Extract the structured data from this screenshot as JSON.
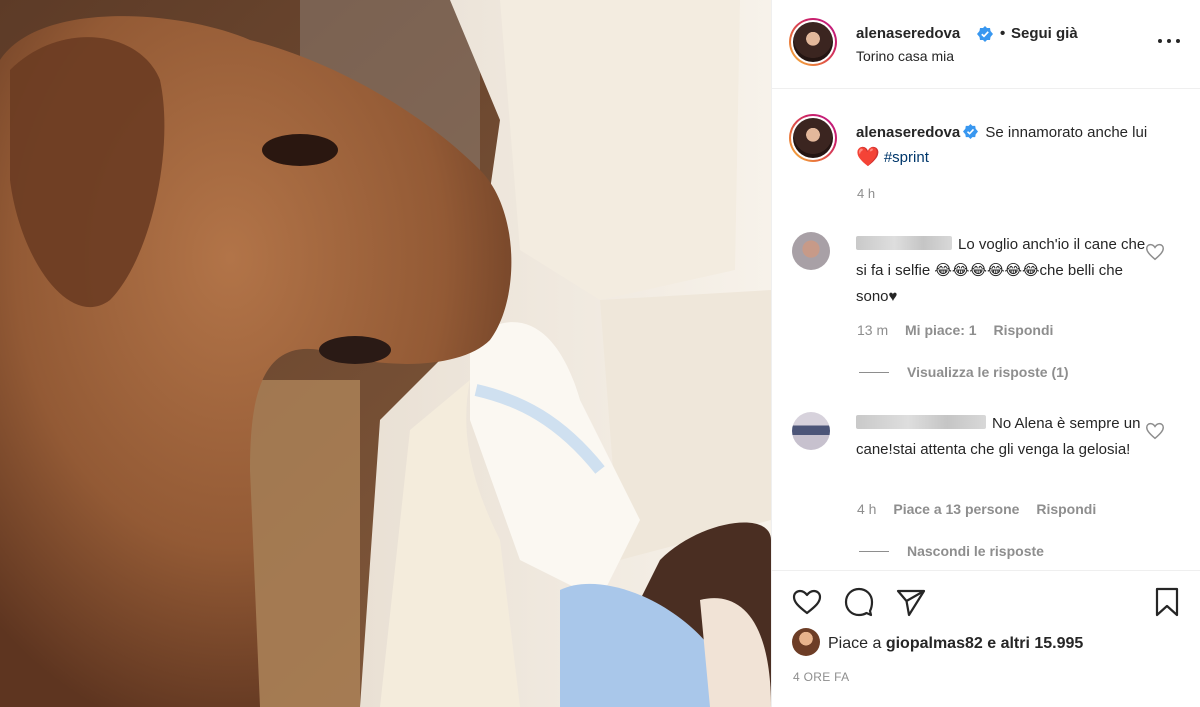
{
  "post": {
    "username": "alenaseredova",
    "follow_status": "Segui già",
    "location": "Torino casa mia",
    "caption_text": "Se innamorato anche lui",
    "caption_heart": "❤️",
    "caption_hashtag": "#sprint",
    "caption_time": "4 h"
  },
  "comments": [
    {
      "text": "Lo voglio anch'io il cane che si fa i selfie 😂😂😂😂😂😂che belli che sono♥",
      "time": "13 m",
      "likes": "Mi piace: 1",
      "reply": "Rispondi",
      "replies_toggle": "Visualizza le risposte (1)"
    },
    {
      "text": "No Alena è sempre un cane!stai attenta che gli venga la gelosia!",
      "time": "4 h",
      "likes": "Piace a 13 persone",
      "reply": "Rispondi",
      "replies_toggle": "Nascondi le risposte"
    }
  ],
  "footer": {
    "likes_prefix": "Piace a",
    "likes_user": "giopalmas82",
    "likes_middle": "e",
    "likes_others": "altri 15.995",
    "date": "4 ORE FA"
  },
  "icons": {
    "more": "more-options-icon",
    "verified": "verified-badge-icon",
    "like": "heart-icon",
    "comment": "comment-icon",
    "share": "send-icon",
    "save": "bookmark-icon"
  },
  "colors": {
    "verified": "#3897f0",
    "hashtag": "#00376b",
    "heart": "#ed4956",
    "muted": "#8e8e8e"
  }
}
